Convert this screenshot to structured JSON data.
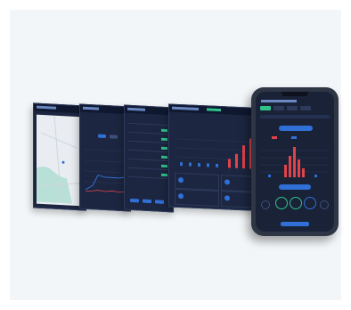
{
  "colors": {
    "panel_bg": "#1c2640",
    "accent_blue": "#2f6fd6",
    "accent_red": "#e0434a",
    "accent_green": "#2fc28a",
    "backdrop": "#f3f6f8"
  },
  "panels": [
    {
      "id": "map",
      "title": ""
    },
    {
      "id": "line-chart",
      "title": ""
    },
    {
      "id": "table",
      "title": ""
    },
    {
      "id": "bar-dashboard",
      "title": ""
    }
  ],
  "phone": {
    "icons": [
      "notch",
      "signal",
      "battery"
    ]
  }
}
